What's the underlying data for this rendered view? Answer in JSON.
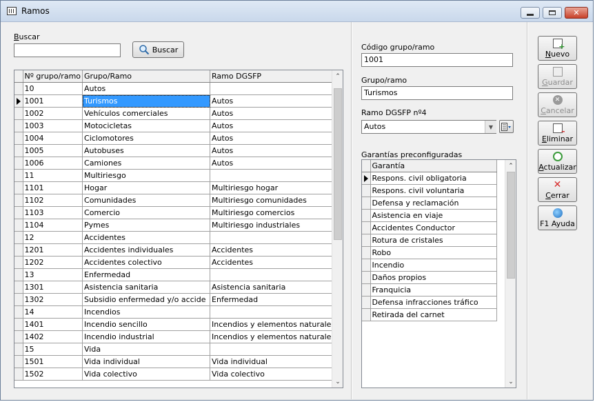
{
  "window": {
    "title": "Ramos"
  },
  "search": {
    "label_first": "B",
    "label_rest": "uscar",
    "value": "",
    "button_label": "Buscar"
  },
  "main_grid": {
    "headers": [
      "Nº grupo/ramo",
      "Grupo/Ramo",
      "Ramo DGSFP"
    ],
    "rows": [
      [
        "10",
        "Autos",
        ""
      ],
      [
        "1001",
        "Turismos",
        "Autos"
      ],
      [
        "1002",
        "Vehículos comerciales",
        "Autos"
      ],
      [
        "1003",
        "Motocicletas",
        "Autos"
      ],
      [
        "1004",
        "Ciclomotores",
        "Autos"
      ],
      [
        "1005",
        "Autobuses",
        "Autos"
      ],
      [
        "1006",
        "Camiones",
        "Autos"
      ],
      [
        "11",
        "Multiriesgo",
        ""
      ],
      [
        "1101",
        "Hogar",
        "Multiriesgo hogar"
      ],
      [
        "1102",
        "Comunidades",
        "Multiriesgo comunidades"
      ],
      [
        "1103",
        "Comercio",
        "Multiriesgo comercios"
      ],
      [
        "1104",
        "Pymes",
        "Multiriesgo industriales"
      ],
      [
        "12",
        "Accidentes",
        ""
      ],
      [
        "1201",
        "Accidentes individuales",
        "Accidentes"
      ],
      [
        "1202",
        "Accidentes colectivo",
        "Accidentes"
      ],
      [
        "13",
        "Enfermedad",
        ""
      ],
      [
        "1301",
        "Asistencia sanitaria",
        "Asistencia sanitaria"
      ],
      [
        "1302",
        "Subsidio enfermedad y/o accide",
        "Enfermedad"
      ],
      [
        "14",
        "Incendios",
        ""
      ],
      [
        "1401",
        "Incendio sencillo",
        "Incendios y elementos naturale"
      ],
      [
        "1402",
        "Incendio industrial",
        "Incendios y elementos naturale"
      ],
      [
        "15",
        "Vida",
        ""
      ],
      [
        "1501",
        "Vida individual",
        "Vida individual"
      ],
      [
        "1502",
        "Vida colectivo",
        "Vida colectivo"
      ]
    ]
  },
  "detail": {
    "codigo_label": "Código grupo/ramo",
    "codigo_value": "1001",
    "grupo_label": "Grupo/ramo",
    "grupo_value": "Turismos",
    "dgsfp_label": "Ramo DGSFP nº4",
    "dgsfp_value": "Autos",
    "garantias_label": "Garantías preconfiguradas",
    "garantias_header": "Garantía",
    "garantias": [
      "Respons. civil obligatoria",
      "Respons. civil voluntaria",
      "Defensa y reclamación",
      "Asistencia en viaje",
      "Accidentes Conductor",
      "Rotura de cristales",
      "Robo",
      "Incendio",
      "Daños propios",
      "Franquicia",
      "Defensa infracciones tráfico",
      "Retirada del carnet"
    ]
  },
  "actions": {
    "nuevo": {
      "u": "N",
      "rest": "uevo"
    },
    "guardar": {
      "u": "G",
      "rest": "uardar"
    },
    "cancelar": {
      "u": "C",
      "rest": "ancelar"
    },
    "eliminar": {
      "u": "E",
      "rest": "liminar"
    },
    "actualizar": {
      "u": "A",
      "rest": "ctualizar"
    },
    "cerrar": {
      "u": "C",
      "rest": "errar"
    },
    "ayuda": "F1 Ayuda"
  },
  "colors": {
    "selection": "#3399ff",
    "close_button": "#c8412a"
  },
  "icons": [
    "app-icon",
    "search-icon",
    "new-icon",
    "save-icon",
    "cancel-icon",
    "delete-icon",
    "refresh-icon",
    "close-icon",
    "help-icon"
  ]
}
